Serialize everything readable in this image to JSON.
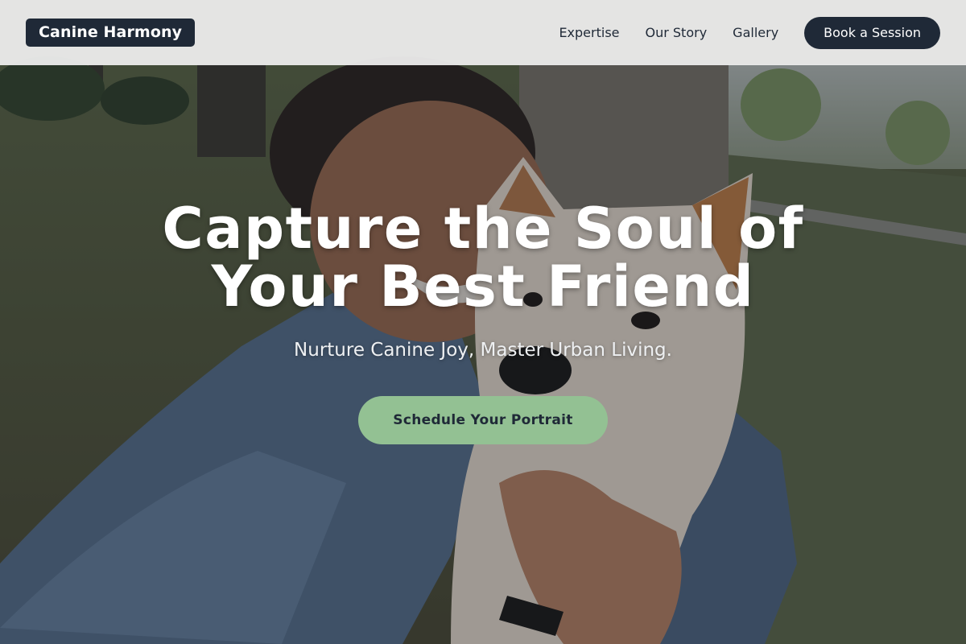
{
  "header": {
    "brand": "Canine Harmony",
    "nav": [
      {
        "label": "Expertise"
      },
      {
        "label": "Our Story"
      },
      {
        "label": "Gallery"
      }
    ],
    "cta_label": "Book a Session"
  },
  "hero": {
    "title_line1": "Capture the Soul of",
    "title_line2": "Your Best Friend",
    "subtitle": "Nurture Canine Joy, Master Urban Living.",
    "cta_label": "Schedule Your Portrait",
    "background_image": "person-with-shiba-inu-selfie-in-park"
  },
  "colors": {
    "primary_dark": "#1f2937",
    "accent_green": "#93c193",
    "header_bg": "#eeeeee"
  }
}
